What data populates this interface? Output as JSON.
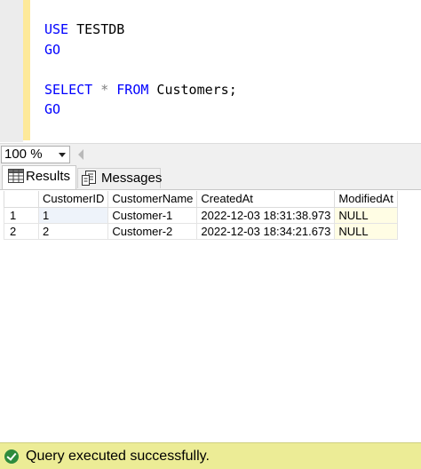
{
  "editor": {
    "lines": [
      {
        "kw1": "USE",
        "rest": " TESTDB"
      },
      {
        "kw1": "GO"
      },
      {
        "blank": true
      },
      {
        "kw1": "SELECT",
        "op": " * ",
        "kw2": "FROM",
        "rest": " Customers;"
      },
      {
        "kw1": "GO"
      }
    ]
  },
  "zoom": {
    "value": "100 %"
  },
  "tabs": {
    "results_label": "Results",
    "messages_label": "Messages"
  },
  "grid": {
    "columns": [
      "CustomerID",
      "CustomerName",
      "CreatedAt",
      "ModifiedAt"
    ],
    "rows": [
      {
        "num": "1",
        "cells": [
          "1",
          "Customer-1",
          "2022-12-03 18:31:38.973",
          "NULL"
        ]
      },
      {
        "num": "2",
        "cells": [
          "2",
          "Customer-2",
          "2022-12-03 18:34:21.673",
          "NULL"
        ]
      }
    ]
  },
  "status": {
    "text": "Query executed successfully."
  },
  "colors": {
    "status_bg": "#ecec96",
    "keyword": "#0000ff",
    "null_bg": "#fffde4",
    "success": "#2e8b3c"
  }
}
